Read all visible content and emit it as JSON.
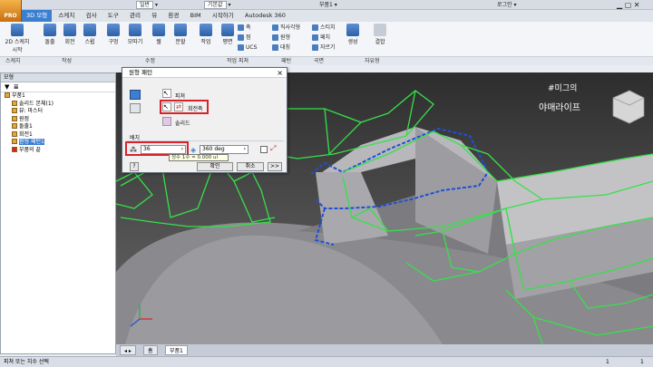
{
  "app": {
    "logo_text": "PRO"
  },
  "quick_access": {
    "style_select": "일반",
    "material_select": "기본값",
    "doc_title": "부품1",
    "login": "로그인"
  },
  "ribbon_tabs": [
    "3D 모형",
    "스케치",
    "검사",
    "도구",
    "관리",
    "뷰",
    "환경",
    "BIM",
    "시작하기",
    "Autodesk 360"
  ],
  "ribbon": {
    "buttons": [
      "2D 스케치 시작",
      "돌출",
      "회전",
      "스윕",
      "구멍",
      "모따기",
      "쉘",
      "분할",
      "작업",
      "평면",
      "생성",
      "결합"
    ],
    "small": [
      "축",
      "점",
      "UCS",
      "직사각형",
      "원형",
      "대칭",
      "스티치",
      "패치",
      "자르기"
    ],
    "panels": [
      "스케치",
      "작성",
      "수정",
      "작업 피쳐",
      "패턴",
      "곡면",
      "자유형"
    ]
  },
  "browser": {
    "title": "모형",
    "tree": [
      "부품1",
      "솔리드 본체(1)",
      "뷰: 마스터",
      "원점",
      "돌출1",
      "회전1",
      "원형 패턴1",
      "부품의 끝"
    ]
  },
  "dialog": {
    "title": "원형 패턴",
    "feature_label": "피쳐",
    "axis_label": "회전축",
    "solid_label": "솔리드",
    "placement_label": "배치",
    "count_value": "36",
    "angle_value": "360 deg",
    "ok": "확인",
    "cancel": "취소",
    "more": ">>",
    "help": "?"
  },
  "tooltip": "정수 1수 = 0.000 ul",
  "watermark": {
    "line1": "#미그의",
    "line2": "야매라이프"
  },
  "doc_tabs": [
    "홈",
    "부품1"
  ],
  "status": {
    "left": "피쳐 또는 치수 선택",
    "right1": "1",
    "right2": "1"
  }
}
